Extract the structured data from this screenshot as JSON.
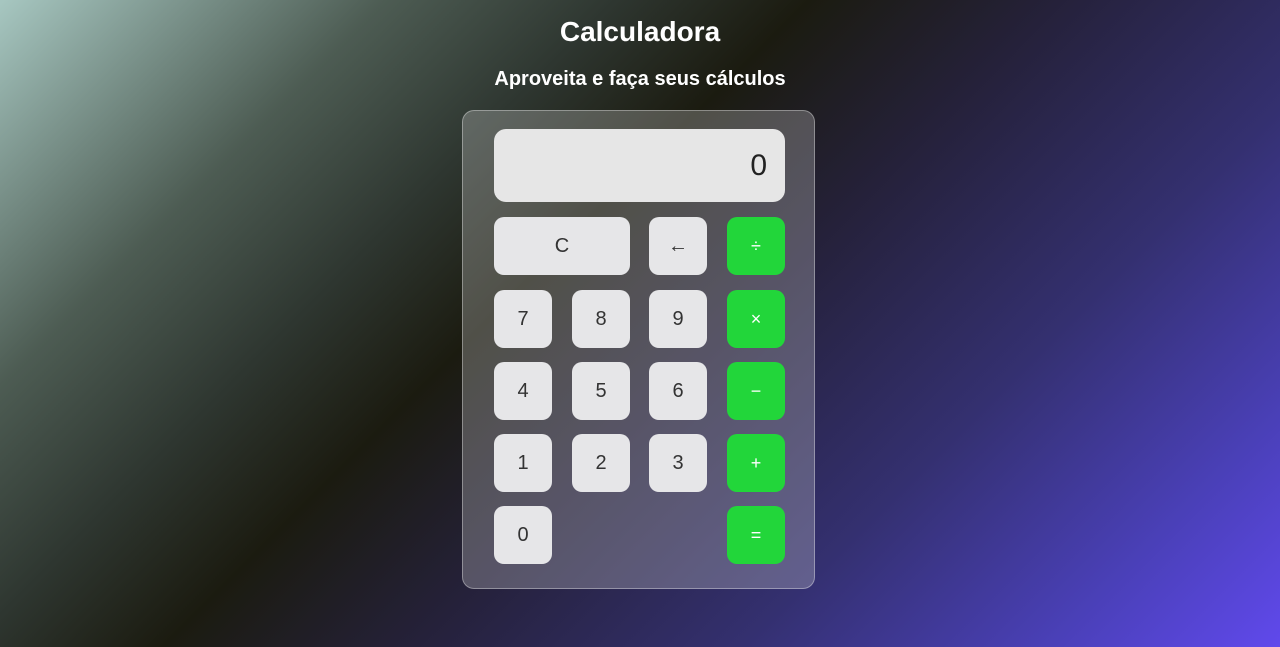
{
  "page": {
    "title": "Calculadora",
    "subtitle": "Aproveita e faça seus cálculos"
  },
  "calculator": {
    "display": "0",
    "buttons": {
      "clear": "C",
      "backspace": "←",
      "divide": "÷",
      "multiply": "×",
      "subtract": "−",
      "add": "+",
      "equals": "=",
      "seven": "7",
      "eight": "8",
      "nine": "9",
      "four": "4",
      "five": "5",
      "six": "6",
      "one": "1",
      "two": "2",
      "three": "3",
      "zero": "0"
    }
  },
  "colors": {
    "operator": "#22d63a",
    "key": "#e6e6e8",
    "display": "#e6e6e6"
  }
}
